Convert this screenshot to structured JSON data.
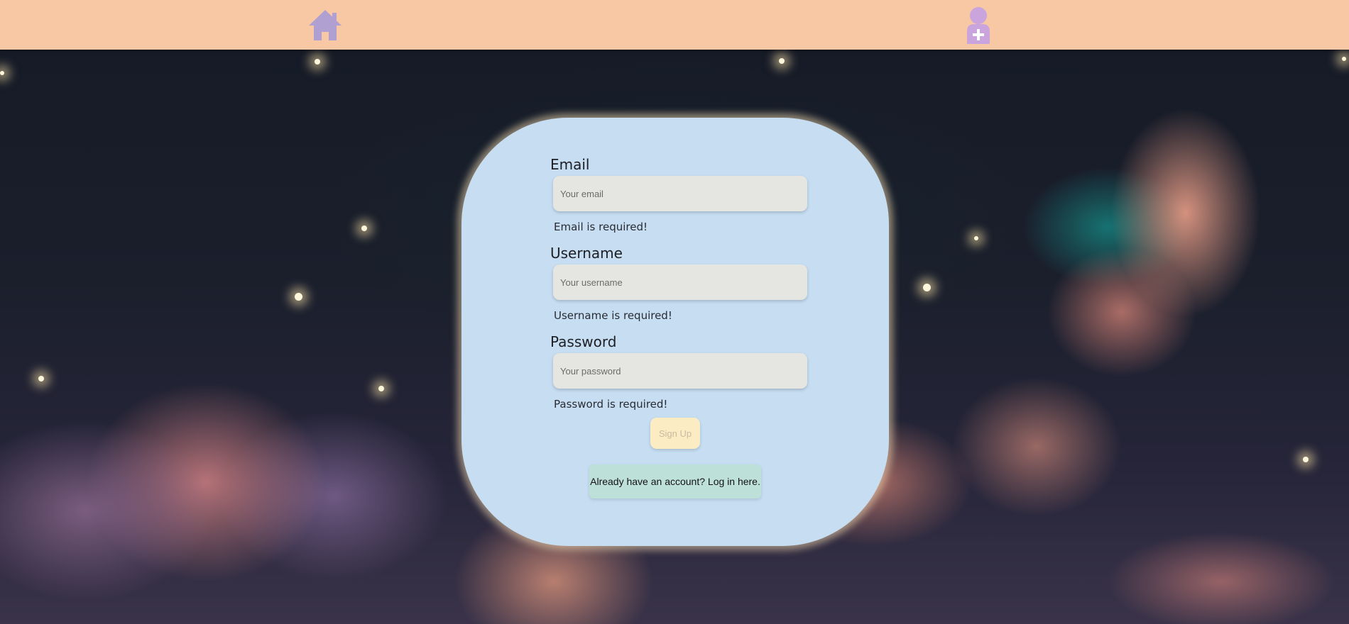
{
  "nav": {
    "home_icon": "home-icon",
    "signup_icon": "user-add-icon",
    "background_color": "#f8c8a5",
    "icon_color_home": "#b0a0d2",
    "icon_color_user": "#c9a4dd"
  },
  "form": {
    "email": {
      "label": "Email",
      "placeholder": "Your email",
      "value": "",
      "error": "Email is required!"
    },
    "username": {
      "label": "Username",
      "placeholder": "Your username",
      "value": "",
      "error": "Username is required!"
    },
    "password": {
      "label": "Password",
      "placeholder": "Your password",
      "value": "",
      "error": "Password is required!"
    },
    "submit_label": "Sign Up",
    "login_link": "Already have an account? Log in here."
  },
  "colors": {
    "card": "#c6ddf2",
    "input": "#e5e5e1",
    "button": "#fbecc3",
    "login_link": "#bde0d8"
  }
}
